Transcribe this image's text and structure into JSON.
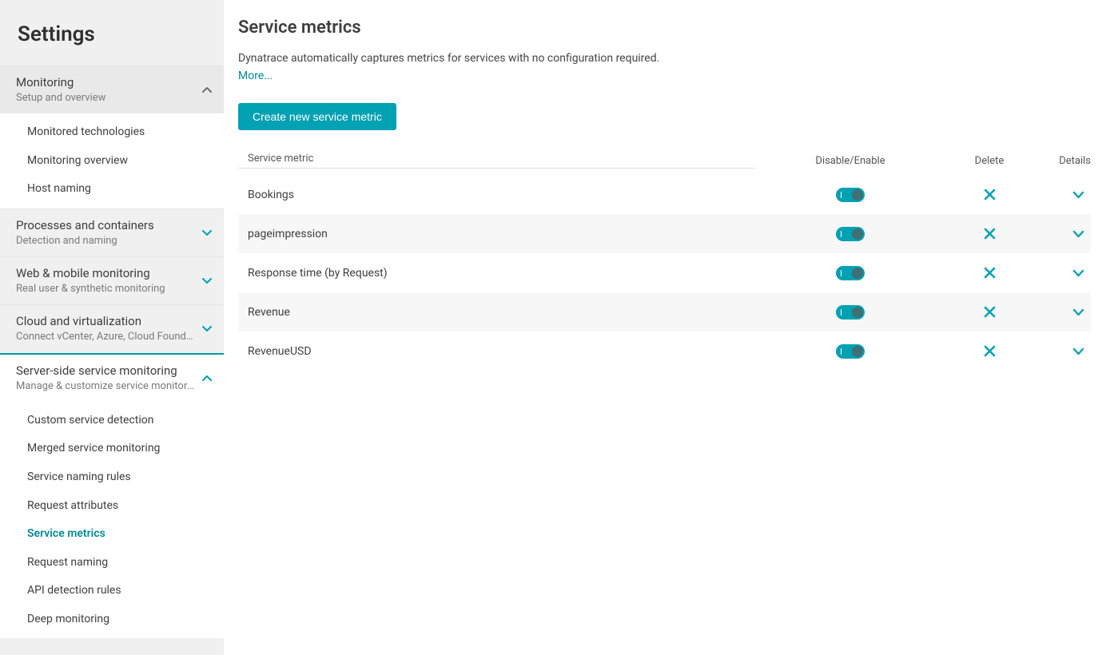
{
  "colors": {
    "accent": "#00a1b2",
    "link": "#008994"
  },
  "sidebar": {
    "title": "Settings",
    "groups": [
      {
        "title": "Monitoring",
        "subtitle": "Setup and overview",
        "expanded": true,
        "chevron_color": "#6f6f6f",
        "items": [
          {
            "label": "Monitored technologies"
          },
          {
            "label": "Monitoring overview"
          },
          {
            "label": "Host naming"
          }
        ]
      },
      {
        "title": "Processes and containers",
        "subtitle": "Detection and naming",
        "expanded": false,
        "chevron_color": "#00a1b2"
      },
      {
        "title": "Web & mobile monitoring",
        "subtitle": "Real user & synthetic monitoring",
        "expanded": false,
        "chevron_color": "#00a1b2"
      },
      {
        "title": "Cloud and virtualization",
        "subtitle": "Connect vCenter, Azure, Cloud Foundry, K...",
        "expanded": false,
        "chevron_color": "#00a1b2"
      },
      {
        "title": "Server-side service monitoring",
        "subtitle": "Manage & customize service monitoring",
        "expanded": true,
        "active": true,
        "chevron_color": "#00a1b2",
        "items": [
          {
            "label": "Custom service detection"
          },
          {
            "label": "Merged service monitoring"
          },
          {
            "label": "Service naming rules"
          },
          {
            "label": "Request attributes"
          },
          {
            "label": "Service metrics",
            "selected": true
          },
          {
            "label": "Request naming"
          },
          {
            "label": "API detection rules"
          },
          {
            "label": "Deep monitoring"
          }
        ]
      }
    ]
  },
  "main": {
    "title": "Service metrics",
    "description": "Dynatrace automatically captures metrics for services with no configuration required.",
    "more_label": "More...",
    "create_button": "Create new service metric",
    "columns": {
      "name": "Service metric",
      "toggle": "Disable/Enable",
      "delete": "Delete",
      "details": "Details"
    },
    "rows": [
      {
        "name": "Bookings",
        "enabled": true
      },
      {
        "name": "pageimpression",
        "enabled": true
      },
      {
        "name": "Response time (by Request)",
        "enabled": true
      },
      {
        "name": "Revenue",
        "enabled": true
      },
      {
        "name": "RevenueUSD",
        "enabled": true
      }
    ]
  }
}
